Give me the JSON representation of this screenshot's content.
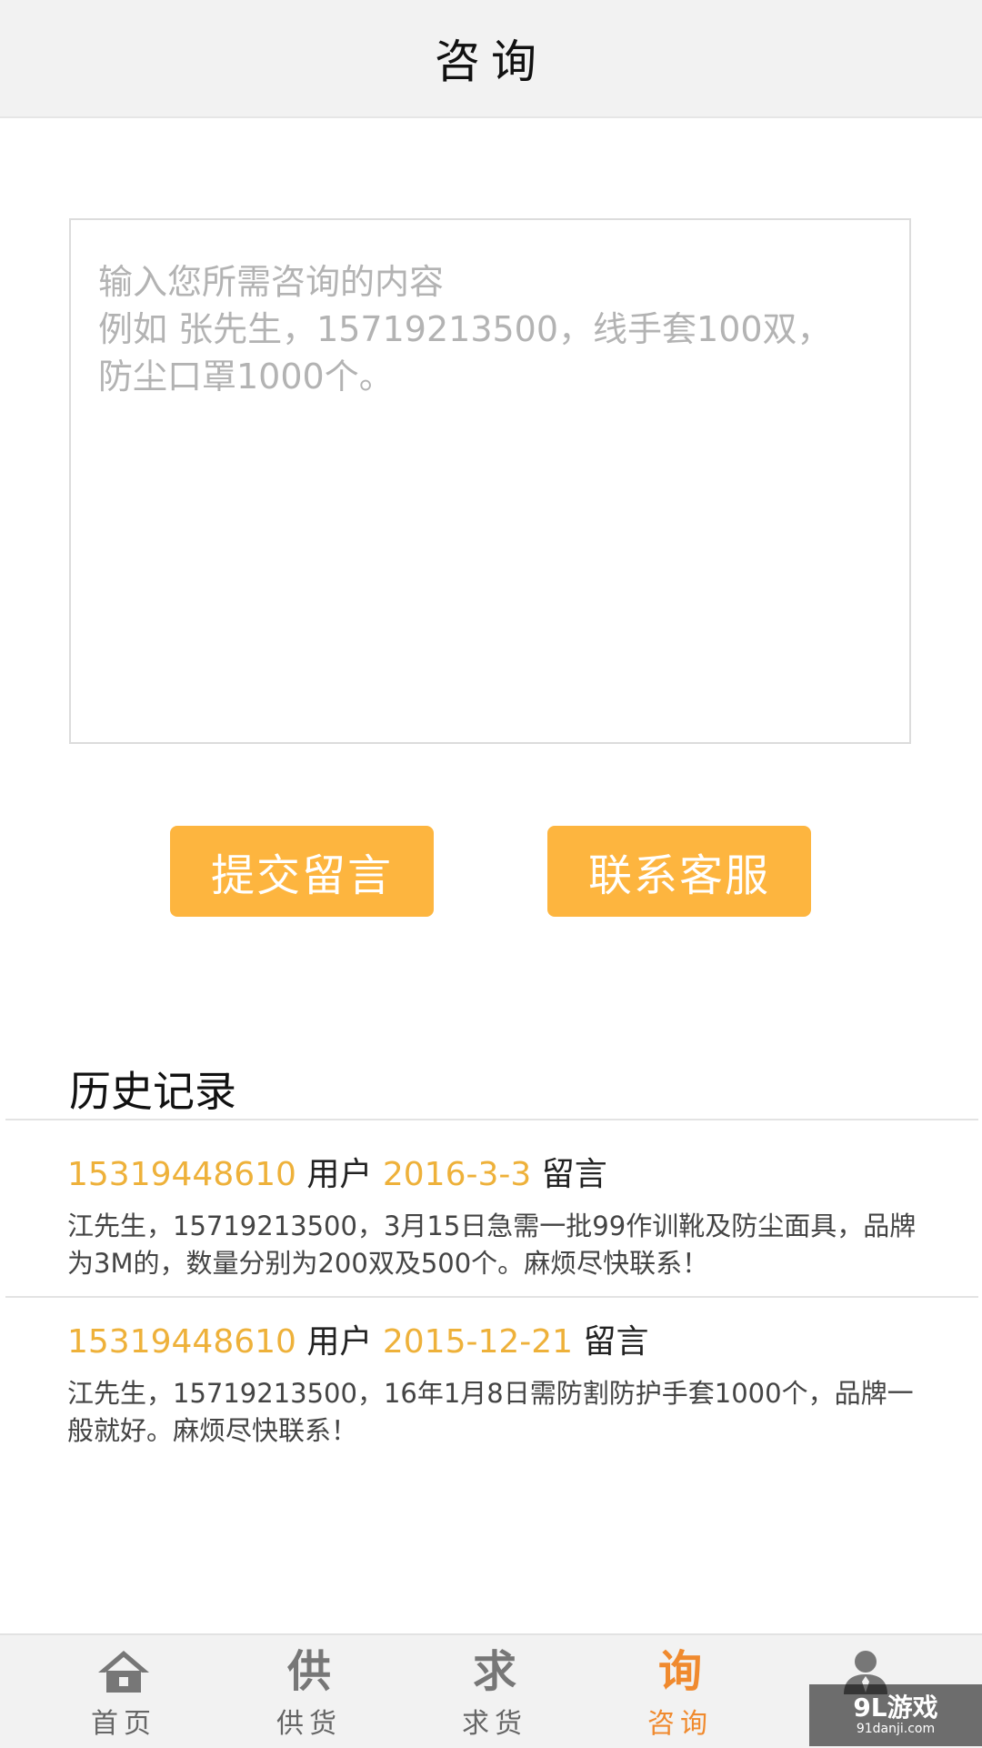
{
  "header": {
    "title": "咨询"
  },
  "consult_input": {
    "placeholder_lines": [
      "输入您所需咨询的内容",
      "例如  张先生，15719213500，线手套100双，",
      "防尘口罩1000个。"
    ]
  },
  "buttons": {
    "submit": "提交留言",
    "contact": "联系客服"
  },
  "history": {
    "title": "历史记录",
    "records": [
      {
        "phone": "15319448610",
        "user_word": "用户",
        "date": "2016-3-3",
        "action_word": "留言",
        "content": "江先生，15719213500，3月15日急需一批99作训靴及防尘面具，品牌为3M的，数量分别为200双及500个。麻烦尽快联系！"
      },
      {
        "phone": "15319448610",
        "user_word": "用户",
        "date": "2015-12-21",
        "action_word": "留言",
        "content": "江先生，15719213500，16年1月8日需防割防护手套1000个，品牌一般就好。麻烦尽快联系！"
      }
    ]
  },
  "tabbar": {
    "items": [
      {
        "label": "首页",
        "icon": "home-icon"
      },
      {
        "label": "供货",
        "icon": "supply-icon",
        "glyph": "供"
      },
      {
        "label": "求货",
        "icon": "demand-icon",
        "glyph": "求"
      },
      {
        "label": "咨询",
        "icon": "consult-icon",
        "glyph": "询"
      },
      {
        "label": "",
        "icon": "user-icon"
      }
    ],
    "active_index": 3,
    "active_color": "#f08a2e"
  },
  "watermark": {
    "logo": "9L游戏",
    "url": "91danji.com"
  },
  "colors": {
    "accent": "#fdb53f",
    "highlight_text": "#eeb13a"
  }
}
